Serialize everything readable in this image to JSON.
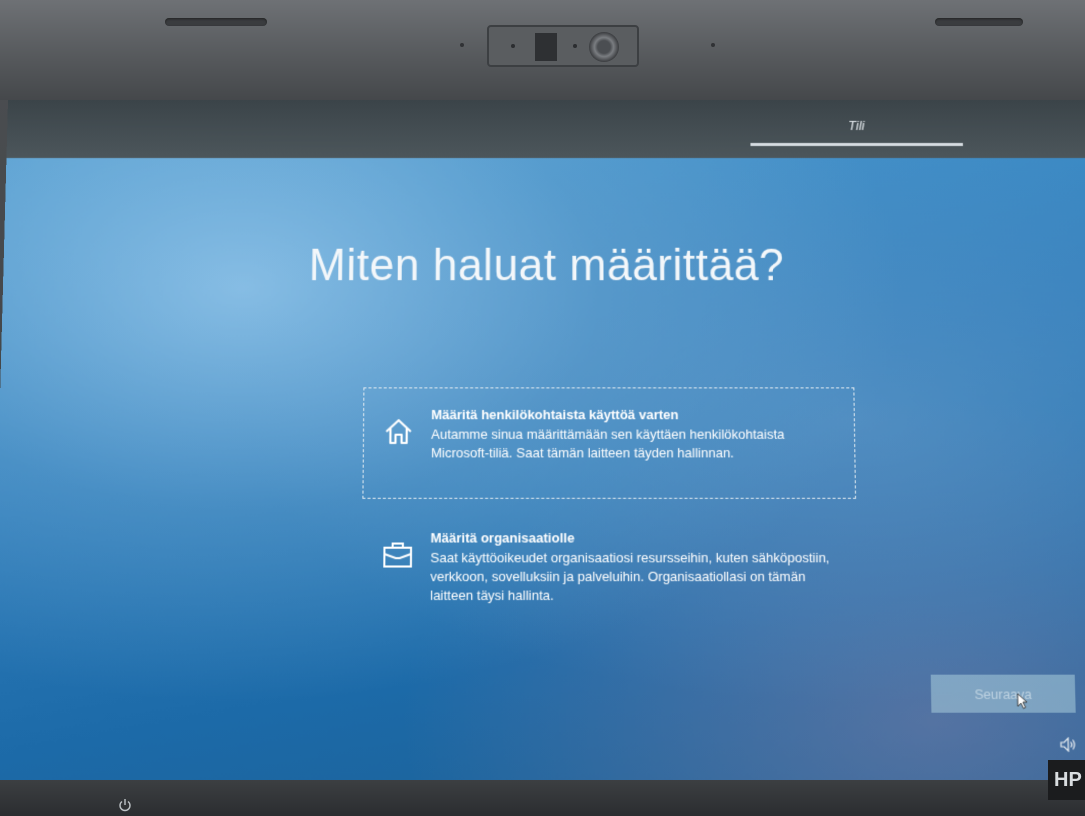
{
  "header": {
    "tab_label": "Tili"
  },
  "main": {
    "title": "Miten haluat määrittää?",
    "options": [
      {
        "title": "Määritä henkilökohtaista käyttöä varten",
        "description": "Autamme sinua määrittämään sen käyttäen henkilökohtaista Microsoft-tiliä. Saat tämän laitteen täyden hallinnan.",
        "icon": "home-icon",
        "selected": true
      },
      {
        "title": "Määritä organisaatiolle",
        "description": "Saat käyttöoikeudet organisaatiosi resursseihin, kuten sähköpostiin, verkkoon, sovelluksiin ja palveluihin. Organisaatiollasi on tämän laitteen täysi hallinta.",
        "icon": "briefcase-icon",
        "selected": false
      }
    ],
    "next_button": {
      "label": "Seuraava",
      "enabled": false
    }
  },
  "footer": {
    "icons": [
      "volume-icon",
      "power-icon"
    ]
  },
  "device": {
    "brand_logo": "HP"
  },
  "colors": {
    "background_blue": "#2f7dbb",
    "topbar": "#434c51",
    "text": "#ffffff"
  }
}
